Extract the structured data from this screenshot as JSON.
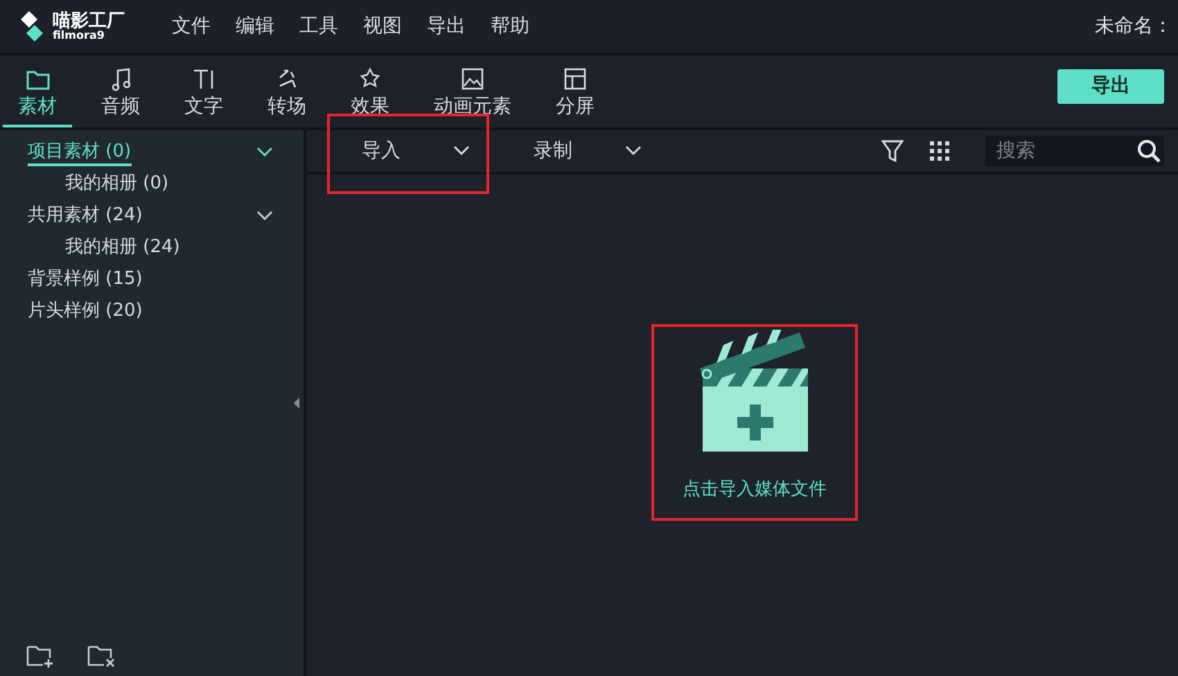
{
  "app": {
    "name": "喵影工厂",
    "subname": "filmora9"
  },
  "menu": [
    "文件",
    "编辑",
    "工具",
    "视图",
    "导出",
    "帮助"
  ],
  "project_title": "未命名：",
  "tabs": [
    {
      "label": "素材",
      "kind": "folder",
      "selected": true
    },
    {
      "label": "音频",
      "kind": "music",
      "selected": false
    },
    {
      "label": "文字",
      "kind": "text",
      "selected": false
    },
    {
      "label": "转场",
      "kind": "transition",
      "selected": false
    },
    {
      "label": "效果",
      "kind": "effect",
      "selected": false
    },
    {
      "label": "动画元素",
      "kind": "image",
      "selected": false
    },
    {
      "label": "分屏",
      "kind": "split",
      "selected": false
    }
  ],
  "export_button": "导出",
  "sidebar": {
    "items": [
      {
        "label": "项目素材 (0)",
        "selected": true,
        "expanded": true,
        "children": [
          {
            "label": "我的相册 (0)",
            "selected": false
          }
        ]
      },
      {
        "label": "共用素材 (24)",
        "selected": false,
        "expanded": true,
        "children": [
          {
            "label": "我的相册 (24)",
            "selected": false
          }
        ]
      },
      {
        "label": "背景样例 (15)",
        "selected": false
      },
      {
        "label": "片头样例 (20)",
        "selected": false
      }
    ]
  },
  "toolbar": {
    "dropdowns": [
      {
        "label": "导入",
        "highlighted": true
      },
      {
        "label": "录制",
        "highlighted": false
      }
    ],
    "search": {
      "placeholder": "搜索"
    }
  },
  "drop_area": {
    "label": "点击导入媒体文件",
    "highlighted": true
  }
}
